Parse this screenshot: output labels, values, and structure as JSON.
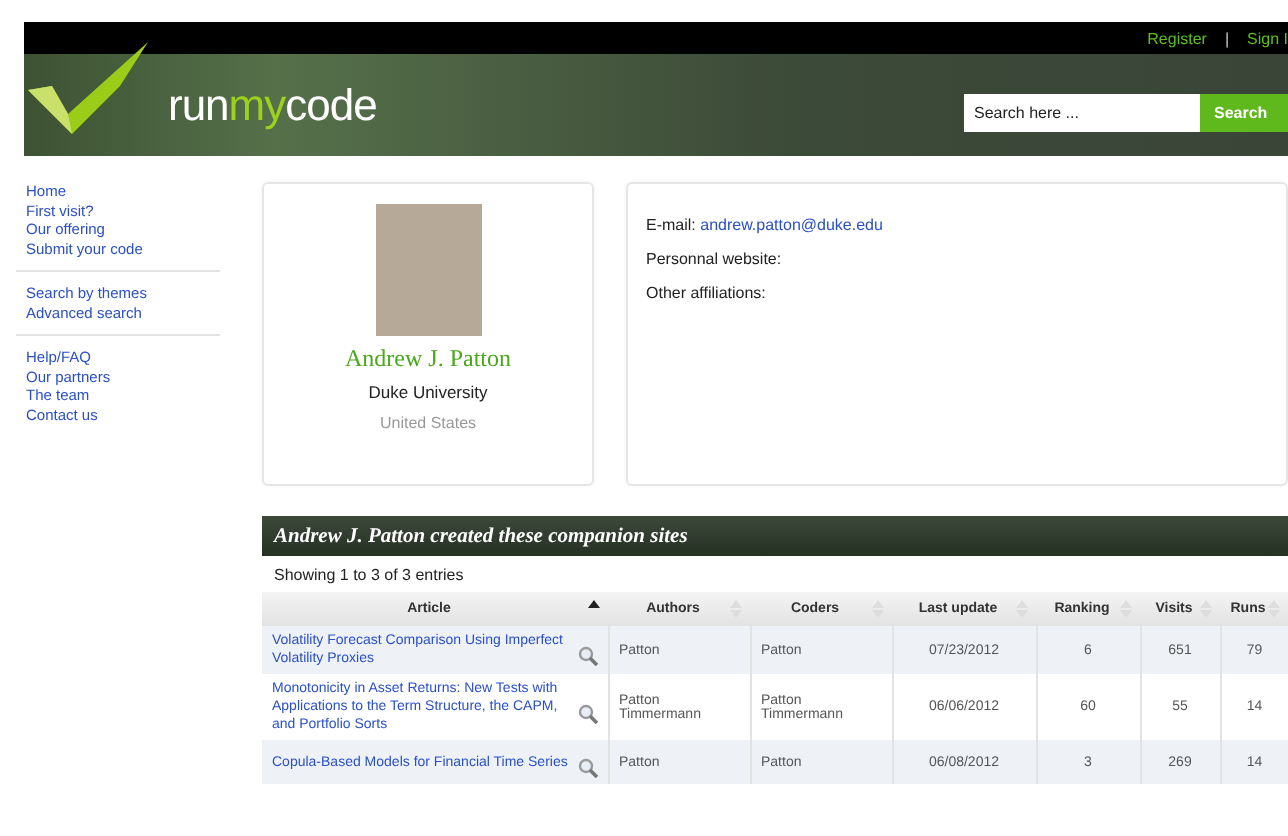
{
  "top_bar": {
    "links": [
      "Register",
      "Sign I"
    ],
    "separator": "|"
  },
  "header": {
    "logo_parts": [
      "run",
      "my",
      "code"
    ],
    "search": {
      "placeholder": "Search here ...",
      "button": "Search"
    }
  },
  "sidebar": {
    "groups": [
      [
        "Home",
        "First visit?",
        "Our offering",
        "Submit your code"
      ],
      [
        "Search by themes",
        "Advanced search"
      ],
      [
        "Help/FAQ",
        "Our partners",
        "The team",
        "Contact us"
      ]
    ]
  },
  "profile": {
    "name": "Andrew J. Patton",
    "institution": "Duke University",
    "country": "United States"
  },
  "details": [
    {
      "label": "E-mail:",
      "value": "andrew.patton@duke.edu"
    },
    {
      "label": "Personnal website:"
    },
    {
      "label": "Other affiliations:"
    }
  ],
  "sites": {
    "title": "Andrew J. Patton created these companion sites",
    "info": "Showing 1 to 3 of 3 entries",
    "columns": [
      {
        "label": "Article",
        "sorted": true
      },
      {
        "label": "Authors",
        "sorted": false
      },
      {
        "label": "Coders",
        "sorted": false
      },
      {
        "label": "Last update",
        "sorted": false
      },
      {
        "label": "Ranking",
        "sorted": false
      },
      {
        "label": "Visits",
        "sorted": false
      },
      {
        "label": "Runs",
        "sorted": false
      }
    ],
    "rows": [
      {
        "article": "Volatility Forecast Comparison Using Imperfect Volatility Proxies",
        "authors": [
          "Patton"
        ],
        "coders": [
          "Patton"
        ],
        "last_update": "07/23/2012",
        "ranking": "6",
        "visits": "651",
        "runs": "79"
      },
      {
        "article": "Monotonicity in Asset Returns: New Tests with Applications to the Term Structure, the CAPM, and Portfolio Sorts",
        "authors": [
          "Patton",
          "Timmermann"
        ],
        "coders": [
          "Patton",
          "Timmermann"
        ],
        "last_update": "06/06/2012",
        "ranking": "60",
        "visits": "55",
        "runs": "14"
      },
      {
        "article": "Copula-Based Models for Financial Time Series",
        "authors": [
          "Patton"
        ],
        "coders": [
          "Patton"
        ],
        "last_update": "06/08/2012",
        "ranking": "3",
        "visits": "269",
        "runs": "14"
      }
    ]
  }
}
